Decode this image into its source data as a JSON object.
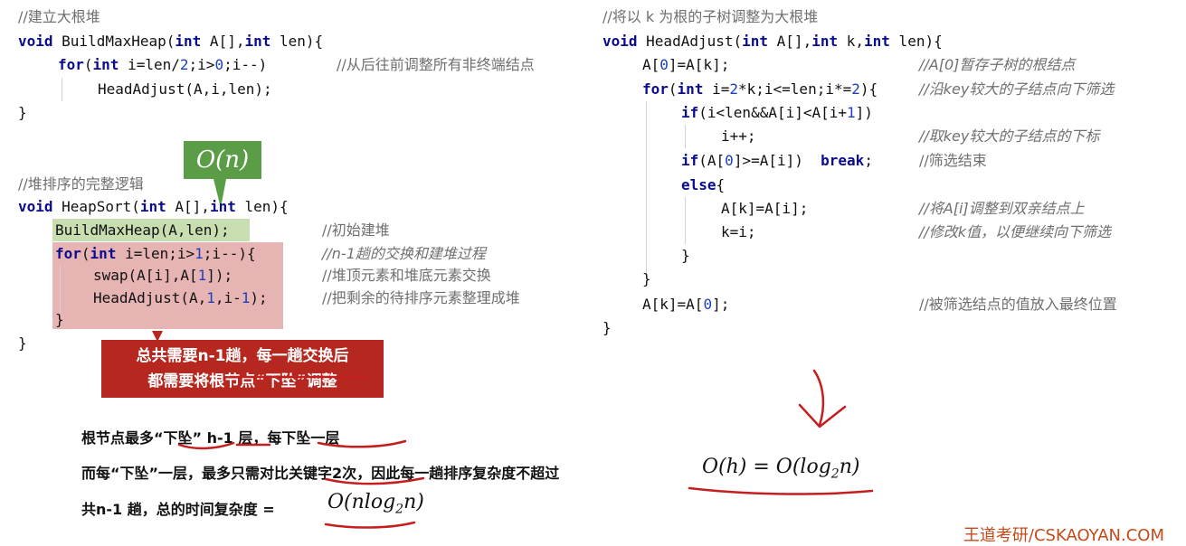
{
  "left": {
    "block1": {
      "comment": "//建立大根堆",
      "l1": {
        "kw1": "void",
        "name": " BuildMaxHeap(",
        "kw2": "int",
        "p1": " A[],",
        "kw3": "int",
        "p2": " len){"
      },
      "l2": {
        "kw1": "for",
        "p1": "(",
        "kw2": "int",
        "p2": " i=len/",
        "n1": "2",
        "p3": ";i>",
        "n2": "0",
        "p4": ";i--)"
      },
      "l2_comment": "//从后往前调整所有非终端结点",
      "l3": "HeadAdjust(A,i,len);",
      "l4": "}"
    },
    "block2": {
      "comment": "//堆排序的完整逻辑",
      "l1": {
        "kw1": "void",
        "name": " HeapSort(",
        "kw2": "int",
        "p1": " A[],",
        "kw3": "int",
        "p2": " len){"
      },
      "l2": "BuildMaxHeap(A,len);",
      "l2_comment": "//初始建堆",
      "l3": {
        "kw1": "for",
        "p1": "(",
        "kw2": "int",
        "p2": " i=len;i>",
        "n1": "1",
        "p3": ";i--){"
      },
      "l3_comment": "//n-1趟的交换和建堆过程",
      "l4": {
        "p1": "swap(A[i],A[",
        "n1": "1",
        "p2": "]);"
      },
      "l4_comment": "//堆顶元素和堆底元素交换",
      "l5": {
        "p1": "HeadAdjust(A,",
        "n1": "1",
        "p2": ",i-",
        "n2": "1",
        "p3": ");"
      },
      "l5_comment": "//把剩余的待排序元素整理成堆",
      "l6": "}",
      "l7": "}"
    },
    "bubble": "O(n)",
    "callout": {
      "line1": "总共需要n-1趟，每一趟交换后",
      "line2": "都需要将根节点“下坠”调整"
    }
  },
  "right": {
    "comment": "//将以 k 为根的子树调整为大根堆",
    "l1": {
      "kw1": "void",
      "name": " HeadAdjust(",
      "kw2": "int",
      "p1": " A[],",
      "kw3": "int",
      "p2": " k,",
      "kw4": "int",
      "p3": " len){"
    },
    "l2": {
      "p1": "A[",
      "n1": "0",
      "p2": "]=A[k];"
    },
    "l2_comment": "//A[0]暂存子树的根结点",
    "l3": {
      "kw1": "for",
      "p1": "(",
      "kw2": "int",
      "p2": " i=",
      "n1": "2",
      "p3": "*k;i<=len;i*=",
      "n2": "2",
      "p4": "){"
    },
    "l3_comment": "//沿key较大的子结点向下筛选",
    "l4": {
      "kw1": "if",
      "p1": "(i<len&&A[i]<A[i+",
      "n1": "1",
      "p2": "])"
    },
    "l5": "i++;",
    "l5_comment": "//取key较大的子结点的下标",
    "l6": {
      "kw1": "if",
      "p1": "(A[",
      "n1": "0",
      "p2": "]>=A[i])  ",
      "kw2": "break",
      "p3": ";"
    },
    "l6_comment": "//筛选结束",
    "l7": {
      "kw1": "else",
      "p1": "{"
    },
    "l8": "A[k]=A[i];",
    "l8_comment": "//将A[i]调整到双亲结点上",
    "l9": "k=i;",
    "l9_comment": "//修改k值，以便继续向下筛选",
    "l10": "}",
    "l11": "}",
    "l12": {
      "p1": "A[k]=A[",
      "n1": "0",
      "p2": "];"
    },
    "l12_comment": "//被筛选结点的值放入最终位置",
    "l13": "}"
  },
  "notes": {
    "n1": {
      "a": "根节点最多“",
      "b": "下坠",
      "c": "” h-1 层，",
      "d": "每下坠一层"
    },
    "n2": {
      "a": "而每“下坠”一层，最多只需对",
      "b": "比关键字2次",
      "c": "，因此每一趟排序复杂度不超过"
    },
    "n2_math": {
      "a": "O(h) = O(log",
      "sub": "2",
      "b": "n)"
    },
    "n3": {
      "a": "共n-1 趟，总的时间复杂度 = "
    },
    "n3_math": {
      "a": "O(nlog",
      "sub": "2",
      "b": "n)"
    }
  },
  "footer": "王道考研/CSKAOYAN.COM",
  "colors": {
    "ink": "#c41e1e",
    "green_bubble": "#5b9d46",
    "red_callout": "#b5271f",
    "green_highlight": "#c8deb0",
    "red_highlight": "#e6b4b2"
  }
}
